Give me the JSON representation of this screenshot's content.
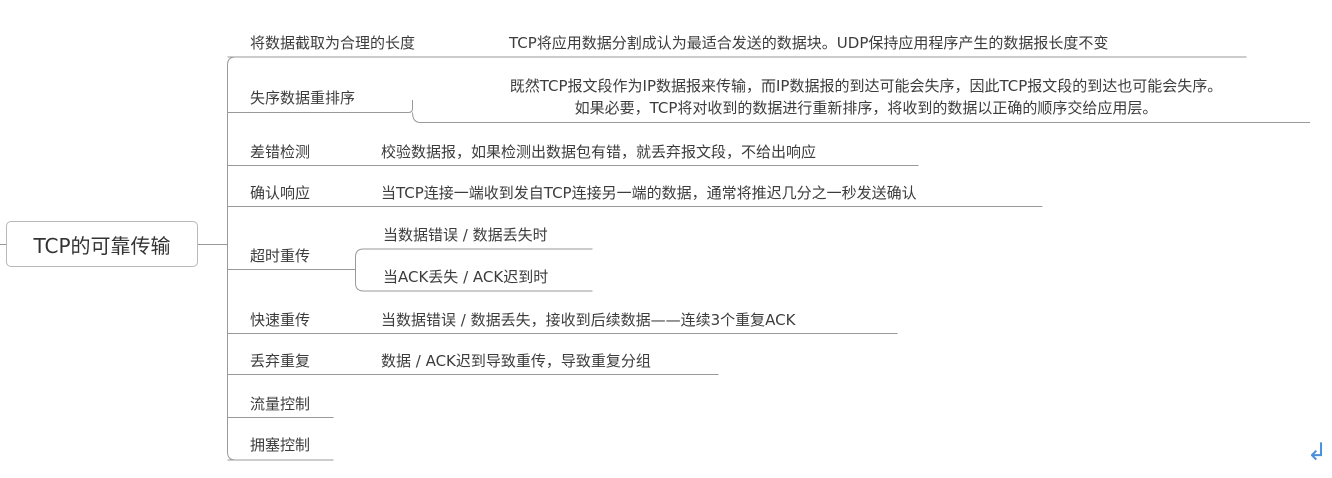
{
  "root": {
    "label": "TCP的可靠传输"
  },
  "branches": [
    {
      "label": "将数据截取为合理的长度",
      "details": [
        "TCP将应用数据分割成认为最适合发送的数据块。UDP保持应用程序产生的数据报长度不变"
      ]
    },
    {
      "label": "失序数据重排序",
      "details": [
        "既然TCP报文段作为IP数据报来传输，而IP数据报的到达可能会失序，因此TCP报文段的到达也可能会失序。",
        "如果必要，TCP将对收到的数据进行重新排序，将收到的数据以正确的顺序交给应用层。"
      ]
    },
    {
      "label": "差错检测",
      "details": [
        "校验数据报，如果检测出数据包有错，就丢弃报文段，不给出响应"
      ]
    },
    {
      "label": "确认响应",
      "details": [
        "当TCP连接一端收到发自TCP连接另一端的数据，通常将推迟几分之一秒发送确认"
      ]
    },
    {
      "label": "超时重传",
      "children": [
        "当数据错误 / 数据丢失时",
        "当ACK丢失 / ACK迟到时"
      ]
    },
    {
      "label": "快速重传",
      "details": [
        "当数据错误 / 数据丢失，接收到后续数据——连续3个重复ACK"
      ]
    },
    {
      "label": "丢弃重复",
      "details": [
        "数据 / ACK迟到导致重传，导致重复分组"
      ]
    },
    {
      "label": "流量控制"
    },
    {
      "label": "拥塞控制"
    }
  ],
  "colors": {
    "line": "#9a9a9a",
    "text": "#3c3c3c",
    "topic_border": "#b9b9b9",
    "icon": "#4a8fdc"
  },
  "icons": {
    "corner": "return-arrow-icon"
  }
}
